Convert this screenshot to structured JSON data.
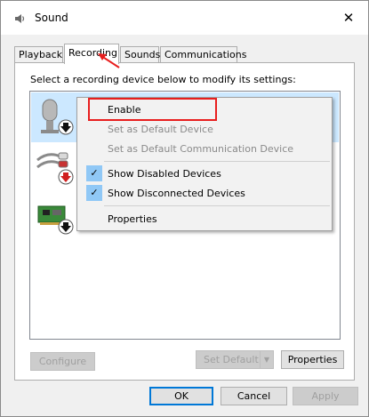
{
  "window": {
    "title": "Sound",
    "close_glyph": "✕"
  },
  "tabs": [
    {
      "label": "Playback"
    },
    {
      "label": "Recording"
    },
    {
      "label": "Sounds"
    },
    {
      "label": "Communications"
    }
  ],
  "instruction": "Select a recording device below to modify its settings:",
  "devices": [
    {
      "icon": "microphone-icon",
      "status": "down-arrow-badge",
      "selected": true
    },
    {
      "icon": "audio-cable-icon",
      "status": "red-down-arrow-badge",
      "selected": false
    },
    {
      "icon": "sound-card-icon",
      "status": "down-arrow-badge",
      "selected": false
    }
  ],
  "context_menu": {
    "items": [
      {
        "label": "Enable",
        "enabled": true,
        "checked": false
      },
      {
        "label": "Set as Default Device",
        "enabled": false,
        "checked": false
      },
      {
        "label": "Set as Default Communication Device",
        "enabled": false,
        "checked": false
      },
      {
        "label": "Show Disabled Devices",
        "enabled": true,
        "checked": true
      },
      {
        "label": "Show Disconnected Devices",
        "enabled": true,
        "checked": true
      },
      {
        "label": "Properties",
        "enabled": true,
        "checked": false
      }
    ]
  },
  "panel_buttons": {
    "configure": "Configure",
    "set_default": "Set Default",
    "properties": "Properties"
  },
  "dialog_buttons": {
    "ok": "OK",
    "cancel": "Cancel",
    "apply": "Apply"
  },
  "colors": {
    "accent": "#0078d7",
    "selection": "#cce8ff",
    "check_bg": "#90c8f6",
    "annotation": "#e81e1e"
  }
}
